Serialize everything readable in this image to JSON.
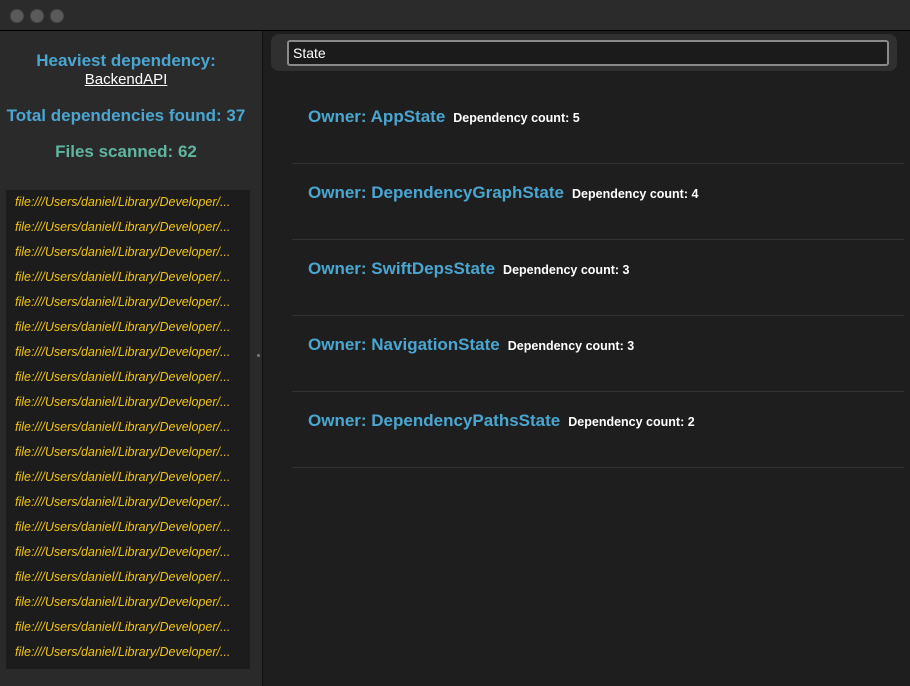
{
  "sidebar": {
    "heaviest_label": "Heaviest dependency:",
    "heaviest_value": "BackendAPI",
    "total_found": "Total dependencies found: 37",
    "files_scanned": "Files scanned: 62",
    "files": [
      "file:///Users/daniel/Library/Developer/...",
      "file:///Users/daniel/Library/Developer/...",
      "file:///Users/daniel/Library/Developer/...",
      "file:///Users/daniel/Library/Developer/...",
      "file:///Users/daniel/Library/Developer/...",
      "file:///Users/daniel/Library/Developer/...",
      "file:///Users/daniel/Library/Developer/...",
      "file:///Users/daniel/Library/Developer/...",
      "file:///Users/daniel/Library/Developer/...",
      "file:///Users/daniel/Library/Developer/...",
      "file:///Users/daniel/Library/Developer/...",
      "file:///Users/daniel/Library/Developer/...",
      "file:///Users/daniel/Library/Developer/...",
      "file:///Users/daniel/Library/Developer/...",
      "file:///Users/daniel/Library/Developer/...",
      "file:///Users/daniel/Library/Developer/...",
      "file:///Users/daniel/Library/Developer/...",
      "file:///Users/daniel/Library/Developer/...",
      "file:///Users/daniel/Library/Developer/..."
    ]
  },
  "search": {
    "value": "State"
  },
  "owners": [
    {
      "name": "Owner: AppState",
      "count": "Dependency count: 5"
    },
    {
      "name": "Owner: DependencyGraphState",
      "count": "Dependency count: 4"
    },
    {
      "name": "Owner: SwiftDepsState",
      "count": "Dependency count: 3"
    },
    {
      "name": "Owner: NavigationState",
      "count": "Dependency count: 3"
    },
    {
      "name": "Owner: DependencyPathsState",
      "count": "Dependency count: 2"
    }
  ],
  "colors": {
    "accent": "#4aa6d1",
    "files_green": "#5fb6a0",
    "file_path": "#f0c419"
  }
}
